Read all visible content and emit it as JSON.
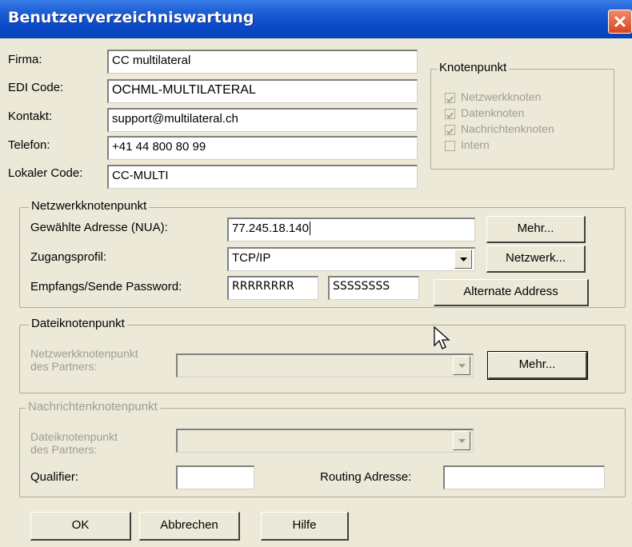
{
  "window": {
    "title": "Benutzerverzeichniswartung"
  },
  "main": {
    "firma": {
      "label": "Firma:",
      "value": "CC multilateral"
    },
    "edi_code": {
      "label": "EDI Code:",
      "value": "OCHML-MULTILATERAL"
    },
    "kontakt": {
      "label": "Kontakt:",
      "value": "support@multilateral.ch"
    },
    "telefon": {
      "label": "Telefon:",
      "value": "+41 44 800 80 99"
    },
    "lokaler_code": {
      "label": "Lokaler Code:",
      "value": "CC-MULTI"
    }
  },
  "knotenpunkt": {
    "legend": "Knotenpunkt",
    "items": [
      {
        "label": "Netzwerkknoten",
        "checked": true
      },
      {
        "label": "Datenknoten",
        "checked": true
      },
      {
        "label": "Nachrichtenknoten",
        "checked": true
      },
      {
        "label": "Intern",
        "checked": false
      }
    ]
  },
  "netzwerkknotenpunkt": {
    "legend": "Netzwerkknotenpunkt",
    "address_label": "Gewählte Adresse (NUA):",
    "address_value": "77.245.18.140",
    "mehr_button": "Mehr...",
    "profile_label": "Zugangsprofil:",
    "profile_value": "TCP/IP",
    "netzwerk_button": "Netzwerk...",
    "password_label": "Empfangs/Sende Password:",
    "receive_password": "RRRRRRRR",
    "send_password": "SSSSSSSS",
    "alternate_button": "Alternate Address"
  },
  "dateiknotenpunkt": {
    "legend": "Dateiknotenpunkt",
    "partner_label_1": "Netzwerkknotenpunkt",
    "partner_label_2": "des Partners:",
    "mehr_button": "Mehr..."
  },
  "nachrichtenknotenpunkt": {
    "legend": "Nachrichtenknotenpunkt",
    "partner_label_1": "Dateiknotenpunkt",
    "partner_label_2": "des Partners:",
    "qualifier_label": "Qualifier:",
    "qualifier_value": "",
    "routing_label": "Routing Adresse:",
    "routing_value": ""
  },
  "footer": {
    "ok": "OK",
    "cancel": "Abbrechen",
    "help": "Hilfe"
  }
}
